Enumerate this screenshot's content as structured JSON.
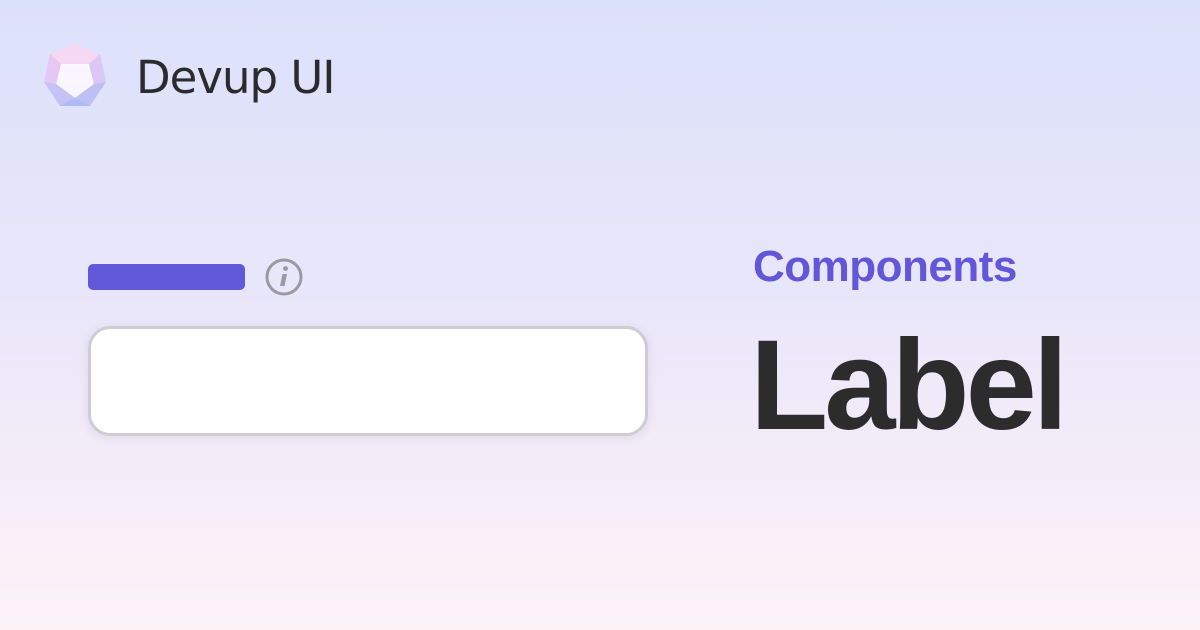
{
  "brand": {
    "name": "Devup UI",
    "logo_icon": "crystal-polygon-icon"
  },
  "demo": {
    "label_color": "#6159d9",
    "info_icon": "info-icon",
    "field_value": ""
  },
  "heading": {
    "category": "Components",
    "title": "Label"
  },
  "colors": {
    "accent": "#6157d8",
    "text": "#2c2c2c",
    "background_top": "#dce1fb",
    "background_bottom": "#fdf3f7"
  }
}
